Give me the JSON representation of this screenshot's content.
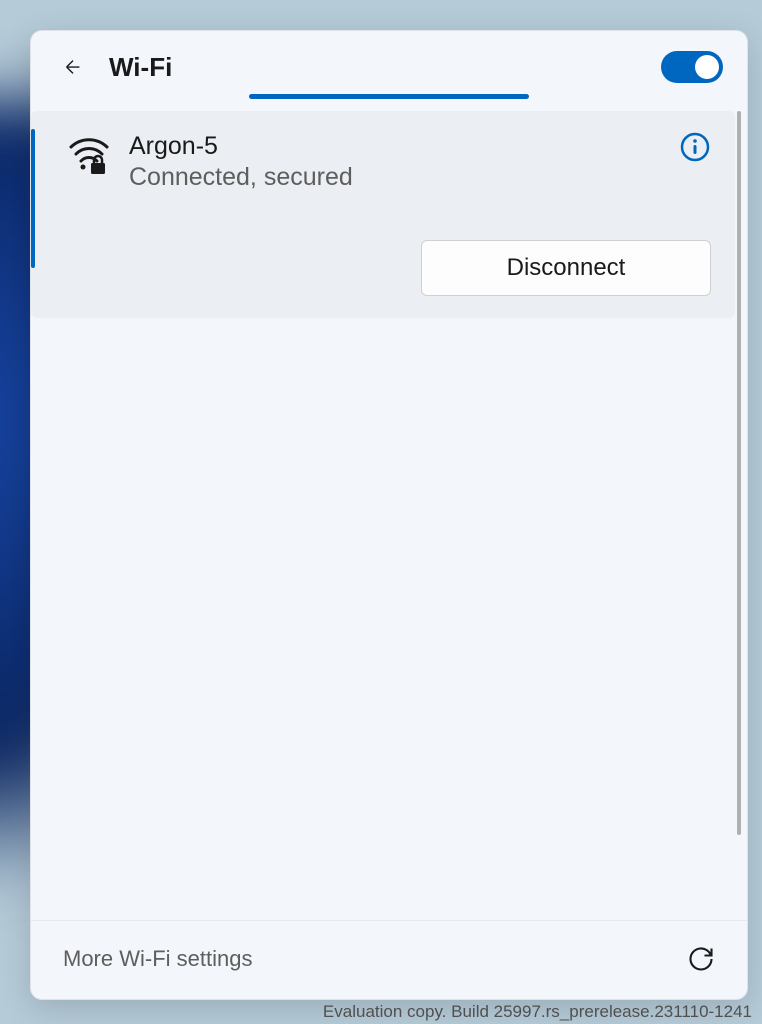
{
  "header": {
    "title": "Wi-Fi",
    "toggle_on": true
  },
  "network": {
    "name": "Argon-5",
    "status": "Connected, secured",
    "disconnect_label": "Disconnect"
  },
  "footer": {
    "more_settings_label": "More Wi-Fi settings"
  },
  "watermark": "Evaluation copy. Build 25997.rs_prerelease.231110-1241",
  "colors": {
    "accent": "#0067c0",
    "panel_bg": "#f3f6fb",
    "item_bg": "#ebeef3"
  }
}
